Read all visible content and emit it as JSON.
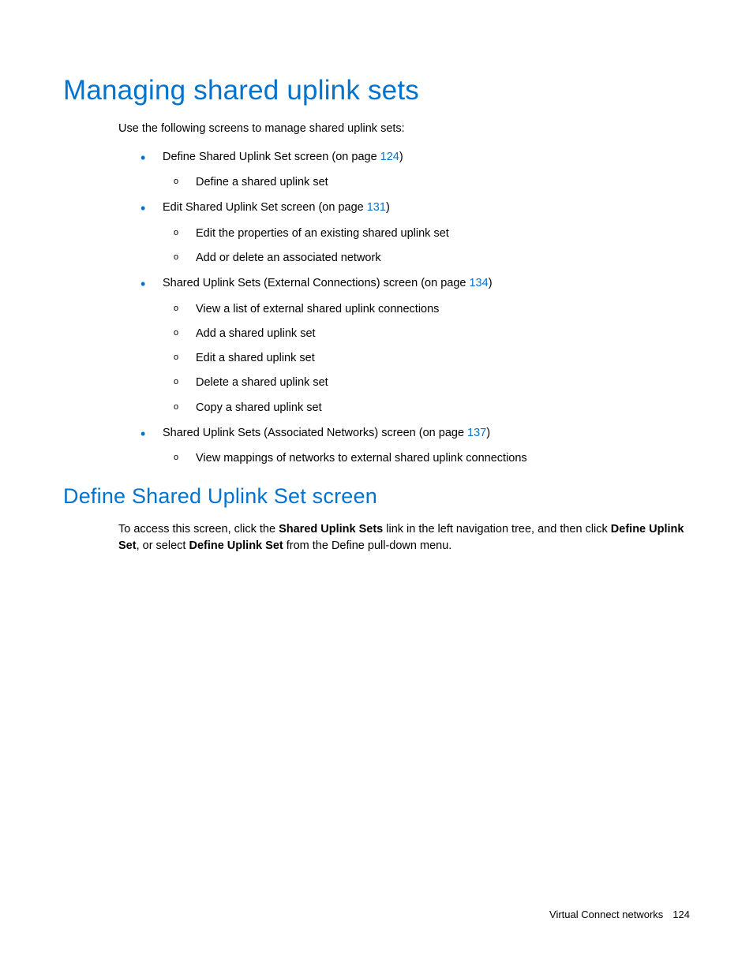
{
  "h1": "Managing shared uplink sets",
  "intro": "Use the following screens to manage shared uplink sets:",
  "b1": {
    "text_before": "Define Shared Uplink Set screen (on page ",
    "page": "124",
    "text_after": ")",
    "subs": [
      "Define a shared uplink set"
    ]
  },
  "b2": {
    "text_before": "Edit Shared Uplink Set screen (on page ",
    "page": "131",
    "text_after": ")",
    "subs": [
      "Edit the properties of an existing shared uplink set",
      "Add or delete an associated network"
    ]
  },
  "b3": {
    "text_before": "Shared Uplink Sets (External Connections) screen (on page ",
    "page": "134",
    "text_after": ")",
    "subs": [
      "View a list of external shared uplink connections",
      "Add a shared uplink set",
      "Edit a shared uplink set",
      "Delete a shared uplink set",
      "Copy a shared uplink set"
    ]
  },
  "b4": {
    "text_before": "Shared Uplink Sets (Associated Networks) screen (on page ",
    "page": "137",
    "text_after": ")",
    "subs": [
      "View mappings of networks to external shared uplink connections"
    ]
  },
  "h2": "Define Shared Uplink Set screen",
  "para": {
    "t1": "To access this screen, click the ",
    "b1": "Shared Uplink Sets",
    "t2": " link in the left navigation tree, and then click ",
    "b2": "Define Uplink Set",
    "t3": ", or select ",
    "b3": "Define Uplink Set",
    "t4": " from the Define pull-down menu."
  },
  "footer": {
    "section": "Virtual Connect networks",
    "page": "124"
  }
}
